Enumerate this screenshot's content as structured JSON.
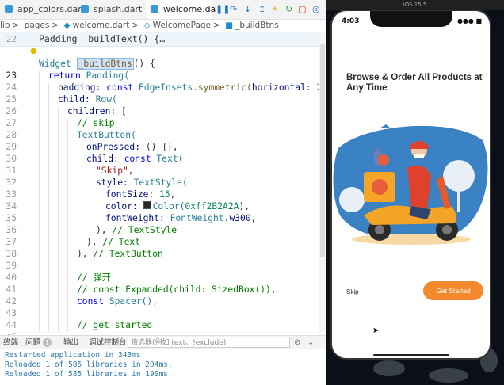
{
  "tabs": [
    {
      "label": "app_colors.dart",
      "active": false
    },
    {
      "label": "splash.dart",
      "active": false
    },
    {
      "label": "welcome.da",
      "active": true
    }
  ],
  "breadcrumb": [
    "lib",
    "pages",
    "welcome.dart",
    "WelcomePage",
    "_buildBtns"
  ],
  "sticky_header": "Padding _buildText() {…",
  "code": {
    "line_numbers": [
      "22",
      "23",
      "24",
      "25",
      "26",
      "27",
      "28",
      "29",
      "30",
      "31",
      "32",
      "33",
      "34",
      "35",
      "36",
      "37",
      "38",
      "39",
      "40",
      "41",
      "42",
      "43",
      "44",
      "45"
    ],
    "l23_a": "Widget ",
    "l23_b": "_buildBtns",
    "l23_c": "() {",
    "l24_a": "return ",
    "l24_b": "Padding(",
    "l25_a": "padding: ",
    "l25_b": "const ",
    "l25_c": "EdgeInsets",
    "l25_d": ".symmetric(",
    "l25_e": "horizontal: ",
    "l25_f": "20",
    "l25_g": "),",
    "l26_a": "child: ",
    "l26_b": "Row(",
    "l27_a": "children: [",
    "l28": "// skip",
    "l29": "TextButton(",
    "l30_a": "onPressed: ",
    "l30_b": "() {},",
    "l31_a": "child: ",
    "l31_b": "const ",
    "l31_c": "Text(",
    "l32": "\"Skip\",",
    "l33_a": "style: ",
    "l33_b": "TextStyle(",
    "l34_a": "fontSize: ",
    "l34_b": "15",
    "l34_c": ",",
    "l35_a": "color: ",
    "l35_b": "Color(",
    "l35_c": "0xff2B2A2A",
    "l35_d": "),",
    "l36_a": "fontWeight: ",
    "l36_b": "FontWeight",
    "l36_c": ".w300,",
    "l37_a": "), ",
    "l37_b": "// TextStyle",
    "l38_a": "), ",
    "l38_b": "// Text",
    "l39_a": "), ",
    "l39_b": "// TextButton",
    "l41": "// 弹开",
    "l42": "// const Expanded(child: SizedBox()),",
    "l43_a": "const ",
    "l43_b": "Spacer(),",
    "l45": "// get started"
  },
  "panel": {
    "tabs": [
      "终端",
      "问题",
      "输出",
      "调试控制台"
    ],
    "problems_count": "1",
    "filter_placeholder": "筛选器(例如 text、!exclude)",
    "console_lines": [
      "Restarted application in 343ms.",
      "Reloaded 1 of 585 libraries in 204ms.",
      "Reloaded 1 of 585 libraries in 199ms."
    ]
  },
  "simulator": {
    "bar_label": "iOS 15.5",
    "time": "4:03",
    "title": "Browse & Order All Products at Any Time",
    "skip_label": "Skip",
    "get_started_label": "Get Started",
    "accent_color": "#f3892c",
    "text_color": "#2b2a2a"
  }
}
